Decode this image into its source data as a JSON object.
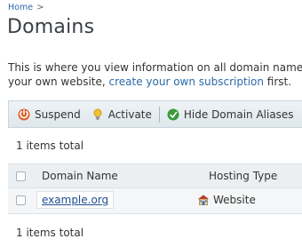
{
  "breadcrumb": {
    "home": "Home",
    "separator": ">"
  },
  "page": {
    "title": "Domains"
  },
  "intro": {
    "line1": "This is where you view information on all domain names",
    "line2_prefix": "your own website, ",
    "line2_link": "create your own subscription",
    "line2_suffix": " first."
  },
  "toolbar": {
    "suspend": {
      "label": "Suspend",
      "icon": "suspend-icon"
    },
    "activate": {
      "label": "Activate",
      "icon": "lightbulb-icon"
    },
    "hide_aliases": {
      "label": "Hide Domain Aliases",
      "icon": "hide-aliases-icon"
    }
  },
  "summary": {
    "top": "1 items total",
    "bottom": "1 items total"
  },
  "table": {
    "columns": {
      "name": "Domain Name",
      "type": "Hosting Type"
    },
    "rows": [
      {
        "name": "example.org",
        "hosting": "Website",
        "hosting_icon": "website-icon"
      }
    ]
  },
  "colors": {
    "link": "#2a6aa8",
    "toolbar_bg": "#e6edf1",
    "header_bg": "#eceff1",
    "row_bg": "#f4f6f7",
    "suspend": "#d9622b",
    "activate": "#e0b02c",
    "hide_aliases": "#3a9a3a"
  }
}
